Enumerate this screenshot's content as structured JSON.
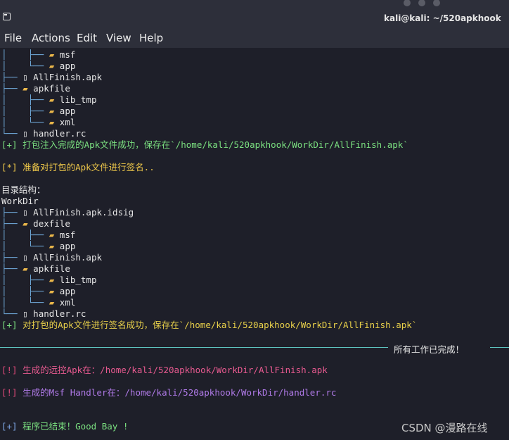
{
  "window": {
    "title": "kali@kali: ~/520apkhook"
  },
  "menu": {
    "items": [
      "File",
      "Actions",
      "Edit",
      "View",
      "Help"
    ]
  },
  "terminal": {
    "tree1": {
      "msf": "msf",
      "app": "app",
      "allfinish_apk": "AllFinish.apk",
      "apkfile": "apkfile",
      "lib_tmp": "lib_tmp",
      "app2": "app",
      "xml": "xml",
      "handler_rc": "handler.rc"
    },
    "pack_success": {
      "prefix": "[+]",
      "text": "打包注入完成的Apk文件成功，保存在`/home/kali/520apkhook/WorkDir/AllFinish.apk`"
    },
    "sign_prepare": {
      "prefix": "[*]",
      "text": "准备对打包的Apk文件进行签名.."
    },
    "dir_structure_label": "目录结构：",
    "workdir_label": "WorkDir",
    "tree2": {
      "idsig": "AllFinish.apk.idsig",
      "dexfile": "dexfile",
      "msf": "msf",
      "app": "app",
      "allfinish_apk": "AllFinish.apk",
      "apkfile": "apkfile",
      "lib_tmp": "lib_tmp",
      "app2": "app",
      "xml": "xml",
      "handler_rc": "handler.rc"
    },
    "sign_success": {
      "prefix": "[+]",
      "text": "对打包的Apk文件进行签名成功，保存在`/home/kali/520apkhook/WorkDir/AllFinish.apk`"
    },
    "all_done": "所有工作已完成！",
    "remote_apk": {
      "prefix": "[!]",
      "text": "生成的远控Apk在：/home/kali/520apkhook/WorkDir/AllFinish.apk"
    },
    "msf_handler": {
      "prefix": "[!]",
      "text": "生成的Msf Handler在：/home/kali/520apkhook/WorkDir/handler.rc"
    },
    "program_end": {
      "prefix": "[+]",
      "text": "程序已结束！Good Bay !"
    }
  },
  "watermark": "CSDN @漫路在线",
  "icons": [
    "terminal-app-icon",
    "folder-icon",
    "file-icon"
  ],
  "colors": {
    "background": "#1e1f29",
    "titlebar": "#2d2f3a",
    "tree_lines": "#6fa8d8",
    "folder": "#e9b64a",
    "success": "#7be080",
    "warning": "#e04a7a",
    "info": "#f0c94a",
    "divider": "#5fc7c2"
  }
}
